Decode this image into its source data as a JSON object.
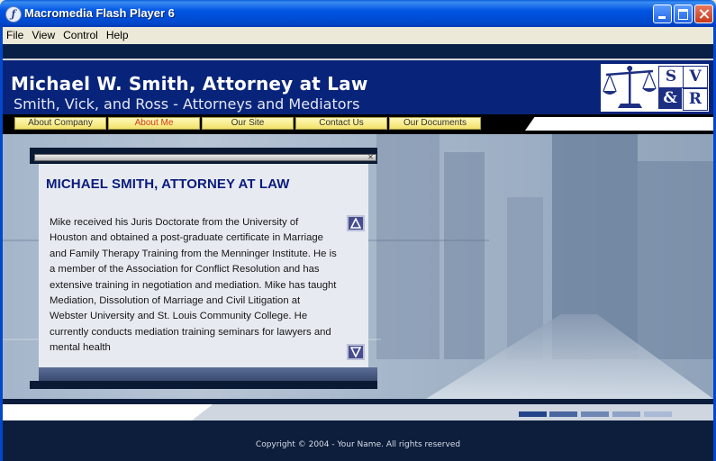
{
  "window": {
    "title": "Macromedia Flash Player 6",
    "app_icon": "flash-icon"
  },
  "menubar": {
    "items": [
      "File",
      "View",
      "Control",
      "Help"
    ]
  },
  "header": {
    "name": "Michael W. Smith, Attorney at Law",
    "firm": "Smith, Vick, and Ross - Attorneys and Mediators",
    "logo_letters": [
      "S",
      "V",
      "&",
      "R"
    ],
    "logo_icon": "scales-of-justice-icon"
  },
  "nav": {
    "items": [
      {
        "label": "About Company",
        "active": false
      },
      {
        "label": "About Me",
        "active": true
      },
      {
        "label": "Our Site",
        "active": false
      },
      {
        "label": "Contact Us",
        "active": false
      },
      {
        "label": "Our Documents",
        "active": false
      }
    ]
  },
  "panel": {
    "title": "MICHAEL SMITH, ATTORNEY AT LAW",
    "body": "Mike received his Juris Doctorate from the University of Houston and obtained a post-graduate certificate in Marriage and Family Therapy Training from the Menninger Institute. He is a member of the Association for Conflict Resolution and has extensive training in negotiation and mediation. Mike has taught Mediation, Dissolution of Marriage and Civil Litigation at Webster University and St. Louis Community College. He currently conducts mediation training seminars for lawyers and mental health",
    "scroll_up_icon": "scroll-up-icon",
    "scroll_down_icon": "scroll-down-icon",
    "close_icon": "close-icon"
  },
  "footer": {
    "copyright": "Copyright © 2004 - Your Name. All rights reserved"
  },
  "colors": {
    "header_bg": "#08247a",
    "nav_button": "#f3e26a",
    "nav_active_text": "#cc3b1e",
    "panel_title": "#0b1b7d",
    "titlebar": "#0054e3"
  }
}
